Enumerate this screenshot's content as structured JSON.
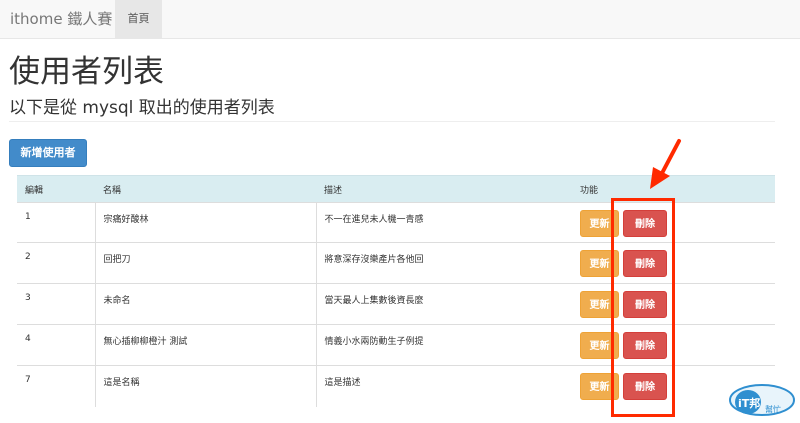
{
  "navbar": {
    "brand": "ithome 鐵人賽",
    "home": "首頁"
  },
  "page": {
    "title": "使用者列表",
    "subtitle": "以下是從 mysql 取出的使用者列表",
    "add_button": "新增使用者"
  },
  "table": {
    "headers": [
      "編輯",
      "名稱",
      "描述",
      "功能"
    ],
    "update_label": "更新",
    "delete_label": "刪除",
    "rows": [
      {
        "id": "1",
        "name": "宗痛好酸林",
        "desc": "不一在進兒未人機一青感"
      },
      {
        "id": "2",
        "name": "回把刀",
        "desc": "將意深存沒樂產片各他回"
      },
      {
        "id": "3",
        "name": "未命名",
        "desc": "當天最人上集數後資長麼"
      },
      {
        "id": "4",
        "name": "無心插柳柳橙汁 測試",
        "desc": "情義小水兩防動生子例提"
      },
      {
        "id": "7",
        "name": "這是名稱",
        "desc": "這是描述"
      }
    ]
  },
  "annotation": {
    "color": "#ff2a00"
  },
  "badge": {
    "text": "iT邦",
    "sub": "幫忙"
  }
}
